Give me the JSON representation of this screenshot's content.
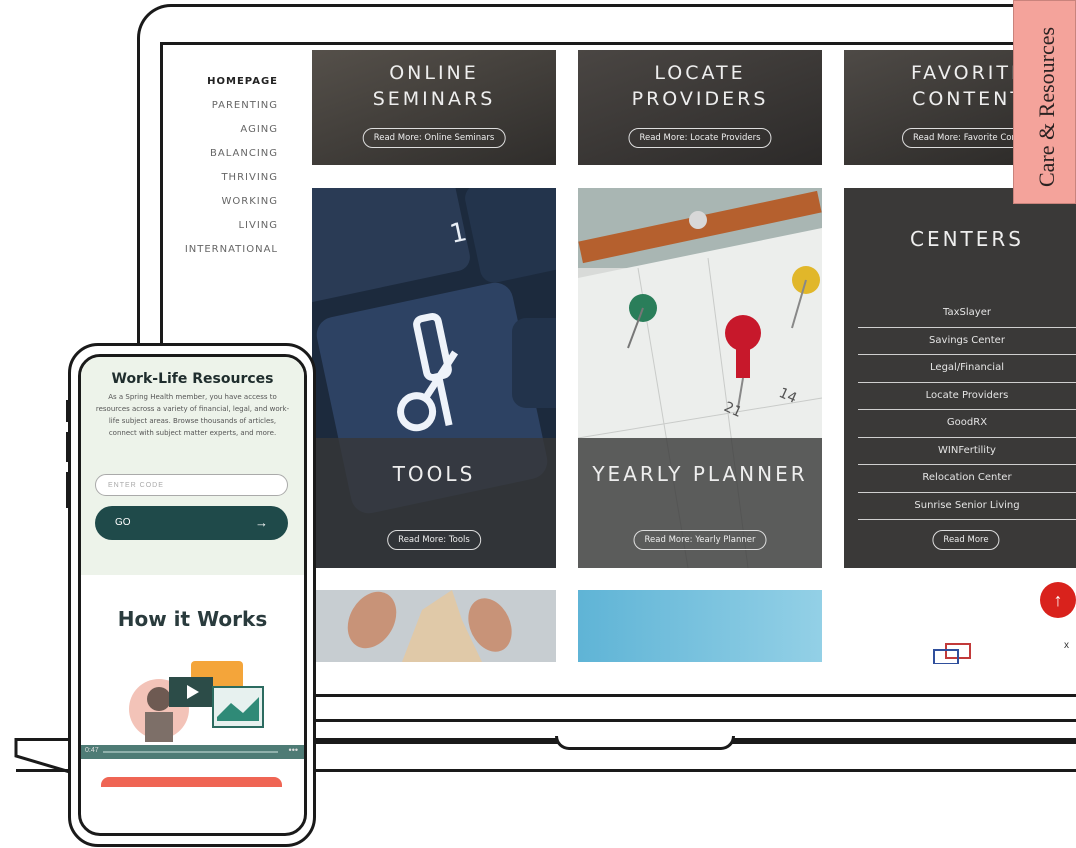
{
  "side_tab": {
    "label": "Care & Resources"
  },
  "nav": {
    "items": [
      "HOMEPAGE",
      "PARENTING",
      "AGING",
      "BALANCING",
      "THRIVING",
      "WORKING",
      "LIVING",
      "INTERNATIONAL"
    ]
  },
  "tiles": {
    "seminars": {
      "title_line1": "ONLINE",
      "title_line2": "SEMINARS",
      "button": "Read More: Online Seminars"
    },
    "providers": {
      "title_line1": "LOCATE",
      "title_line2": "PROVIDERS",
      "button": "Read More: Locate Providers"
    },
    "favorites": {
      "title_line1": "FAVORITE",
      "title_line2": "CONTENT",
      "button": "Read More: Favorite Content"
    },
    "tools": {
      "title": "TOOLS",
      "button": "Read More: Tools"
    },
    "planner": {
      "title": "YEARLY PLANNER",
      "button": "Read More: Yearly Planner"
    },
    "centers": {
      "title": "CENTERS",
      "items": [
        "TaxSlayer",
        "Savings Center",
        "Legal/Financial",
        "Locate Providers",
        "GoodRX",
        "WINFertility",
        "Relocation Center",
        "Sunrise Senior Living"
      ],
      "button": "Read More"
    }
  },
  "scroll_up_icon": "arrow-up-icon",
  "close_label": "x",
  "phone": {
    "title": "Work-Life Resources",
    "body": "As a Spring Health member, you have access to resources across a variety of financial, legal, and work-life subject areas. Browse thousands of articles, connect with subject matter experts, and more.",
    "input_placeholder": "ENTER CODE",
    "go_label": "GO",
    "go_arrow": "→",
    "how_title": "How it Works",
    "video_time": "0:47",
    "video_more": "•••"
  },
  "colors": {
    "accent_red": "#d9221c",
    "phone_button": "#1f4a4a",
    "care_tab": "#f4a39b"
  }
}
